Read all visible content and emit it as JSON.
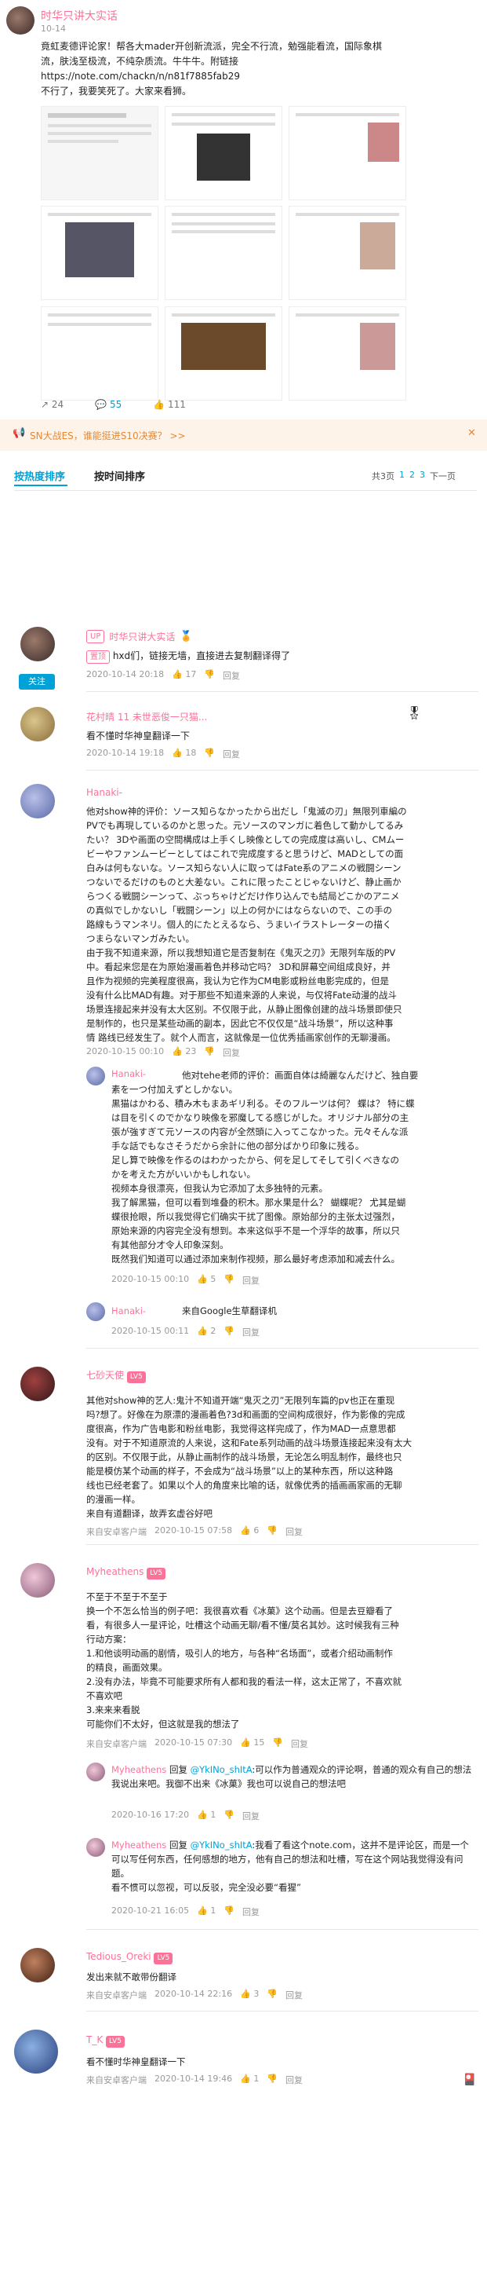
{
  "post": {
    "author": "时华只讲大实话",
    "date": "10-14",
    "text": [
      "竟虹麦德评论家！帮各大mader开创新流派，完全不行流，勉强能看流，国际象棋",
      "流，肤浅至极流，不纯杂质流。牛牛牛。附链接",
      "https://note.com/chackn/n/n81f7885fab29",
      "不行了，我要笑死了。大家来看狮。"
    ],
    "stats": {
      "reposts": "24",
      "comments": "55",
      "likes": "111"
    }
  },
  "notice": {
    "text": "SN大战ES，谁能挺进S10决赛？ >>"
  },
  "sort": {
    "hot": "按热度排序",
    "time": "按时间排序",
    "pages_label": "共3页",
    "pages": [
      "1",
      "2",
      "3"
    ],
    "next": "下一页"
  },
  "comments": [
    {
      "user": "时华只讲大实话",
      "badge": "UP",
      "content_tag": "置顶",
      "content": "hxd们，链接无墙，直接进去复制翻译得了",
      "date": "2020-10-14 20:18",
      "likes": "17",
      "reply": "回复",
      "follow": "关注"
    },
    {
      "user": "花村晴 11 未世恶俊一只猫...",
      "content": "看不懂时华神皇翻译一下",
      "date": "2020-10-14 19:18",
      "likes": "18",
      "reply": "回复"
    },
    {
      "user": "Hanaki-",
      "content": [
        "他对show神的评价：ソース知らなかったから出だし「鬼滅の刃」無限列車編の",
        "PVでも再現しているのかと思った。元ソースのマンガに着色して動かしてるみ",
        "たい？ 3Dや画面の空間構成は上手くし映像としての完成度は高いし、CMムー",
        "ビーやファンムービーとしてはこれで完成度すると思うけど、MADとしての面",
        "白みは何もないな。ソース知らない人に取ってはFate系のアニメの戦闘シーン",
        "つないでるだけのものと大差ない。これに限ったことじゃないけど、静止画か",
        "らつくる戦闘シーンって、ぶっちゃけどだけ作り込んでも結局どこかのアニメ",
        "の真似でしかないし「戦闘シーン」以上の何かにはならないので、この手の",
        "路線もうマンネリ。個人的にたとえるなら、うまいイラストレーターの描く",
        "つまらないマンガみたい。",
        "由于我不知道来源，所以我想知道它是否复制在《鬼灭之刃》无限列车版的PV",
        "中。看起来您是在为原始漫画着色并移动它吗？ 3D和屏幕空间组成良好，并",
        "且作为视频的完美程度很高，我认为它作为CM电影或粉丝电影完成的，但是",
        "没有什么比MAD有趣。对于那些不知道来源的人来说，与仅将Fate动漫的战斗",
        "场景连接起来并没有太大区别。不仅限于此，从静止图像创建的战斗场景即使只",
        "是制作的，也只是某些动画的副本，因此它不仅仅是“战斗场景”，所以这种事",
        "情 路线已经发生了。就个人而言，这就像是一位优秀插画家创作的无聊漫画。"
      ],
      "date": "2020-10-15 00:10",
      "likes": "23",
      "reply": "回复"
    },
    {
      "user": "Hanaki-",
      "reply_prefix": "回复",
      "content": [
        "他对tehe老师的评价：画面自体は綺麗なんだけど、独自要",
        "素を一つ付加えずとしかない。",
        "黒猫はかわる、積み木もまあギリ利る。そのフルーツは何？ 蝶は？ 特に蝶",
        "は目を引くのでかなり映像を邪魔してる感じがした。オリジナル部分の主",
        "張が強すぎて元ソースの内容が全然頭に入ってこなかった。元々そんな派",
        "手な話でもなさそうだから余計に他の部分ばかり印象に残る。",
        "足し算で映像を作るのはわかったから、何を足してそして引くべきなの",
        "かを考えた方がいいかもしれない。",
        "视频本身很漂亮，但我认为它添加了太多独特的元素。",
        "我了解黑猫，但可以看到堆叠的积木。那水果是什么？ 蝴蝶呢？ 尤其是蝴",
        "蝶很抢眼，所以我觉得它们确实干扰了图像。原始部分的主张太过强烈，",
        "原始来源的内容完全没有想到。本来这似乎不是一个浮华的故事，所以只",
        "有其他部分才令人印象深刻。",
        "既然我们知道可以通过添加来制作视频，那么最好考虑添加和减去什么。"
      ],
      "date": "2020-10-15 00:10",
      "likes": "5",
      "reply": "回复"
    },
    {
      "user": "Hanaki-",
      "content": "来自Google生草翻译机",
      "date": "2020-10-15 00:11",
      "likes": "2",
      "reply": "回复"
    },
    {
      "user": "七砂天使",
      "content": [
        "其他对show神的艺人:鬼汁不知道开端“鬼灭之刃”无限列车篇的pv也正在重现",
        "吗?想了。好像在为原漂的漫画着色?3d和画面的空间构成很好，作为影像的完成",
        "度很高，作为广告电影和粉丝电影，我觉得这样完成了，作为MAD一点意思都",
        "没有。对于不知道原流的人来说，这和Fate系列动画的战斗场景连接起来没有太大",
        "的区别。不仅限于此，从静止画制作的战斗场景，无论怎么明乱制作，最终也只",
        "能是模仿某个动画的样子，不会成为“战斗场景”以上的某种东西，所以这种路",
        "线也已经老套了。如果以个人的角度来比喻的话，就像优秀的插画画家画的无聊",
        "的漫画一样。",
        "来自有道翻译，故弄玄虚谷好吧"
      ],
      "date": "2020-10-15 07:58",
      "likes": "6",
      "reply": "回复",
      "client": "来自安卓客户端"
    },
    {
      "user": "Myheathens",
      "content": [
        "不至于不至于不至于",
        "换一个不怎么恰当的例子吧：我很喜欢看《冰菓》这个动画。但是去豆瓣看了",
        "看，有很多人一星评论，吐槽这个动画无聊/看不懂/莫名其妙。这时候我有三种",
        "行动方案：",
        "1.和他谈明动画的剧情，吸引人的地方，与各种“名场面”，或者介绍动画制作",
        "的精良，画面效果。",
        "2.没有办法，毕竟不可能要求所有人都和我的看法一样，这太正常了，不喜欢就",
        "不喜欢吧",
        "3.来来来看脱",
        "可能你们不太好，但这就是我的想法了"
      ],
      "date": "2020-10-15 07:30",
      "likes": "15",
      "reply": "回复",
      "client": "来自安卓客户端"
    },
    {
      "user": "Myheathens",
      "reply_prefix": "回复",
      "mention": "@YkINo_shItA",
      "content": [
        ":可以作为普通观众的评论啊，普通的观众有自己的想法我说出来吧。我御不出来《冰菓》我也可以说自己的想法吧"
      ],
      "date": "2020-10-16 17:20",
      "likes": "1",
      "reply": "回复"
    },
    {
      "user": "Myheathens",
      "reply_prefix": "回复",
      "mention": "@YkINo_shItA",
      "content": [
        ":我看了看这个note.com，这并不是评论区，而是一个可以写任何东西，任何感想的地方，他有自己的想法和吐槽，写在这个网站我觉得没有问题。",
        "看不惯可以忽视，可以反驳，完全没必要“看猩”"
      ],
      "date": "2020-10-21 16:05",
      "likes": "1",
      "reply": "回复"
    },
    {
      "user": "Tedious_Oreki",
      "content": "发出来就不敢带份翻译",
      "date": "2020-10-14 22:16",
      "likes": "3",
      "reply": "回复",
      "client": "来自安卓客户端"
    },
    {
      "user": "T_K",
      "content": "看不懂时华神皇翻译一下",
      "date": "2020-10-14 19:46",
      "likes": "1",
      "reply": "回复",
      "client": "来自安卓客户端"
    }
  ],
  "colors": {
    "accent": "#fb7299",
    "link": "#00a1d6",
    "notice_bg": "#fef3e8",
    "notice_text": "#e68833"
  }
}
